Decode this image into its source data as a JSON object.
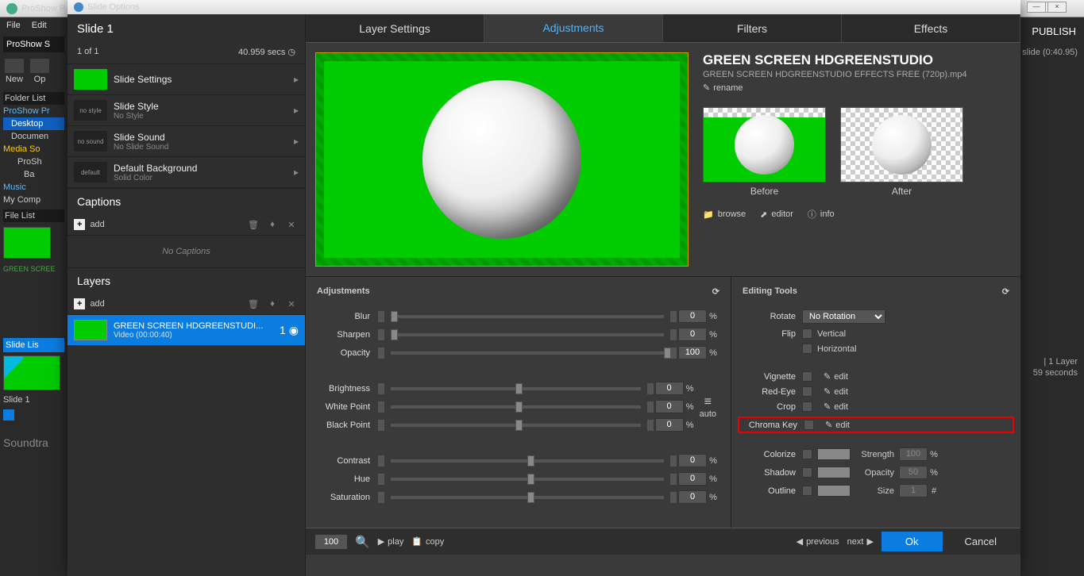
{
  "bg": {
    "title": "ProShow P...",
    "publish": "PUBLISH",
    "slide_info": "slide (0:40.95)",
    "layers_info": "| 1 Layer",
    "secs_info": "59 seconds",
    "file_menu": "File",
    "edit_menu": "Edit",
    "app_label": "ProShow S",
    "new_btn": "New",
    "op_btn": "Op",
    "folder_list": "Folder List",
    "tree": [
      "ProShow Pr",
      "Desktop",
      "Documen",
      "Media So",
      "ProSh",
      "Ba",
      "Music",
      "My Comp"
    ],
    "file_list": "File List",
    "file_name": "GREEN SCREE",
    "slide_list": "Slide Lis",
    "open_tag": "open",
    "slide1": "Slide 1",
    "soundtrack": "Soundtra"
  },
  "dialog": {
    "title": "Slide Options",
    "slide_name": "Slide 1",
    "count": "1 of 1",
    "duration": "40.959 secs",
    "options": [
      {
        "thumb": "green",
        "t1": "Slide Settings",
        "t2": ""
      },
      {
        "thumb": "no style",
        "t1": "Slide Style",
        "t2": "No Style"
      },
      {
        "thumb": "no sound",
        "t1": "Slide Sound",
        "t2": "No Slide Sound"
      },
      {
        "thumb": "default",
        "t1": "Default Background",
        "t2": "Solid Color"
      }
    ],
    "captions_hdr": "Captions",
    "add": "add",
    "no_captions": "No Captions",
    "layers_hdr": "Layers",
    "layer": {
      "name": "GREEN SCREEN HDGREENSTUDI...",
      "sub": "Video (00:00:40)",
      "idx": "1"
    },
    "tabs": [
      "Layer Settings",
      "Adjustments",
      "Filters",
      "Effects"
    ],
    "active_tab": 1,
    "info": {
      "title": "GREEN SCREEN HDGREENSTUDIO",
      "sub": "GREEN SCREEN HDGREENSTUDIO EFFECTS FREE (720p).mp4",
      "rename": "rename",
      "before": "Before",
      "after": "After",
      "browse": "browse",
      "editor": "editor",
      "info_btn": "info"
    },
    "adj_hdr": "Adjustments",
    "tools_hdr": "Editing Tools",
    "sliders1": [
      {
        "name": "Blur",
        "val": "0",
        "pos": 0
      },
      {
        "name": "Sharpen",
        "val": "0",
        "pos": 0
      },
      {
        "name": "Opacity",
        "val": "100",
        "pos": 100
      }
    ],
    "sliders2": [
      {
        "name": "Brightness",
        "val": "0",
        "pos": 50
      },
      {
        "name": "White Point",
        "val": "0",
        "pos": 50
      },
      {
        "name": "Black Point",
        "val": "0",
        "pos": 50
      }
    ],
    "sliders3": [
      {
        "name": "Contrast",
        "val": "0",
        "pos": 50
      },
      {
        "name": "Hue",
        "val": "0",
        "pos": 50
      },
      {
        "name": "Saturation",
        "val": "0",
        "pos": 50
      }
    ],
    "auto": "auto",
    "tools": {
      "rotate_label": "Rotate",
      "rotate_val": "No Rotation",
      "flip_label": "Flip",
      "vertical": "Vertical",
      "horizontal": "Horizontal",
      "vignette": "Vignette",
      "redeye": "Red-Eye",
      "crop": "Crop",
      "chroma": "Chroma Key",
      "edit": "edit",
      "colorize": "Colorize",
      "strength": "Strength",
      "strength_val": "100",
      "shadow": "Shadow",
      "opacity": "Opacity",
      "opacity_val": "50",
      "outline": "Outline",
      "size": "Size",
      "size_val": "1"
    },
    "bottom": {
      "zoom": "100",
      "play": "play",
      "copy": "copy",
      "previous": "previous",
      "next": "next",
      "ok": "Ok",
      "cancel": "Cancel"
    }
  }
}
